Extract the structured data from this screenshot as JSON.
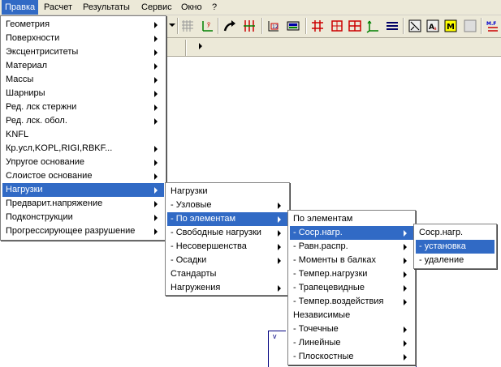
{
  "menubar": {
    "items": [
      {
        "label": "Правка"
      },
      {
        "label": "Расчет"
      },
      {
        "label": "Результаты"
      },
      {
        "label": "Сервис"
      },
      {
        "label": "Окно"
      },
      {
        "label": "?"
      }
    ]
  },
  "edit_menu": {
    "items": [
      {
        "label": "Геометрия",
        "submenu": true
      },
      {
        "label": "Поверхности",
        "submenu": true
      },
      {
        "label": "Эксцентриситеты",
        "submenu": true
      },
      {
        "label": "Материал",
        "submenu": true
      },
      {
        "label": "Массы",
        "submenu": true
      },
      {
        "label": "Шарниры",
        "submenu": true
      },
      {
        "label": "Ред. лск стержни",
        "submenu": true
      },
      {
        "label": "Ред. лск. обол.",
        "submenu": true
      },
      {
        "label": "KNFL",
        "submenu": false
      },
      {
        "label": "Кр.усл,KOPL,RIGI,RBKF...",
        "submenu": true
      },
      {
        "label": "Упругое основание",
        "submenu": true
      },
      {
        "label": "Слоистое основание",
        "submenu": true
      },
      {
        "label": "Нагрузки",
        "submenu": true,
        "selected": true
      },
      {
        "label": "Предварит.напряжение",
        "submenu": true
      },
      {
        "label": "Подконструкции",
        "submenu": true
      },
      {
        "label": "Прогрессирующее разрушение",
        "submenu": true
      }
    ]
  },
  "loads_menu": {
    "header": "Нагрузки",
    "items": [
      {
        "label": "- Узловые",
        "submenu": true
      },
      {
        "label": "- По элементам",
        "submenu": true,
        "selected": true
      },
      {
        "label": "- Свободные нагрузки",
        "submenu": true
      },
      {
        "label": "- Несовершенства",
        "submenu": true
      },
      {
        "label": "- Осадки",
        "submenu": true
      },
      {
        "label": "Стандарты",
        "submenu": false
      },
      {
        "label": "Нагружения",
        "submenu": true
      }
    ]
  },
  "element_menu": {
    "header": "По элементам",
    "items": [
      {
        "label": "- Соср.нагр.",
        "submenu": true,
        "selected": true
      },
      {
        "label": "- Равн.распр.",
        "submenu": true
      },
      {
        "label": "- Моменты в балках",
        "submenu": true
      },
      {
        "label": "- Темпер.нагрузки",
        "submenu": true
      },
      {
        "label": "- Трапецевидные",
        "submenu": true
      },
      {
        "label": "- Темпер.воздействия",
        "submenu": true
      }
    ],
    "header2": "Независимые",
    "items2": [
      {
        "label": "- Точечные",
        "submenu": true
      },
      {
        "label": "- Линейные",
        "submenu": true
      },
      {
        "label": "- Плоскостные",
        "submenu": true
      }
    ]
  },
  "concentrated_menu": {
    "header": "Соср.нагр.",
    "items": [
      {
        "label": "- установка",
        "selected": true
      },
      {
        "label": "- удаление"
      }
    ]
  },
  "toolbar": {
    "icons": [
      "grid-icon",
      "axes-icon",
      "redo-arrow-icon",
      "node-tool-icon",
      "numbering-icon",
      "calculator-icon",
      "beam-grid-icon",
      "frame-icon",
      "table-icon",
      "xyz-axes-icon",
      "layers-icon",
      "display-icon",
      "text-icon",
      "m-icon",
      "mf-icon"
    ]
  },
  "colors": {
    "menu_highlight": "#316ac5",
    "menubar_bg": "#ece9d8",
    "drawing": "#000080"
  }
}
